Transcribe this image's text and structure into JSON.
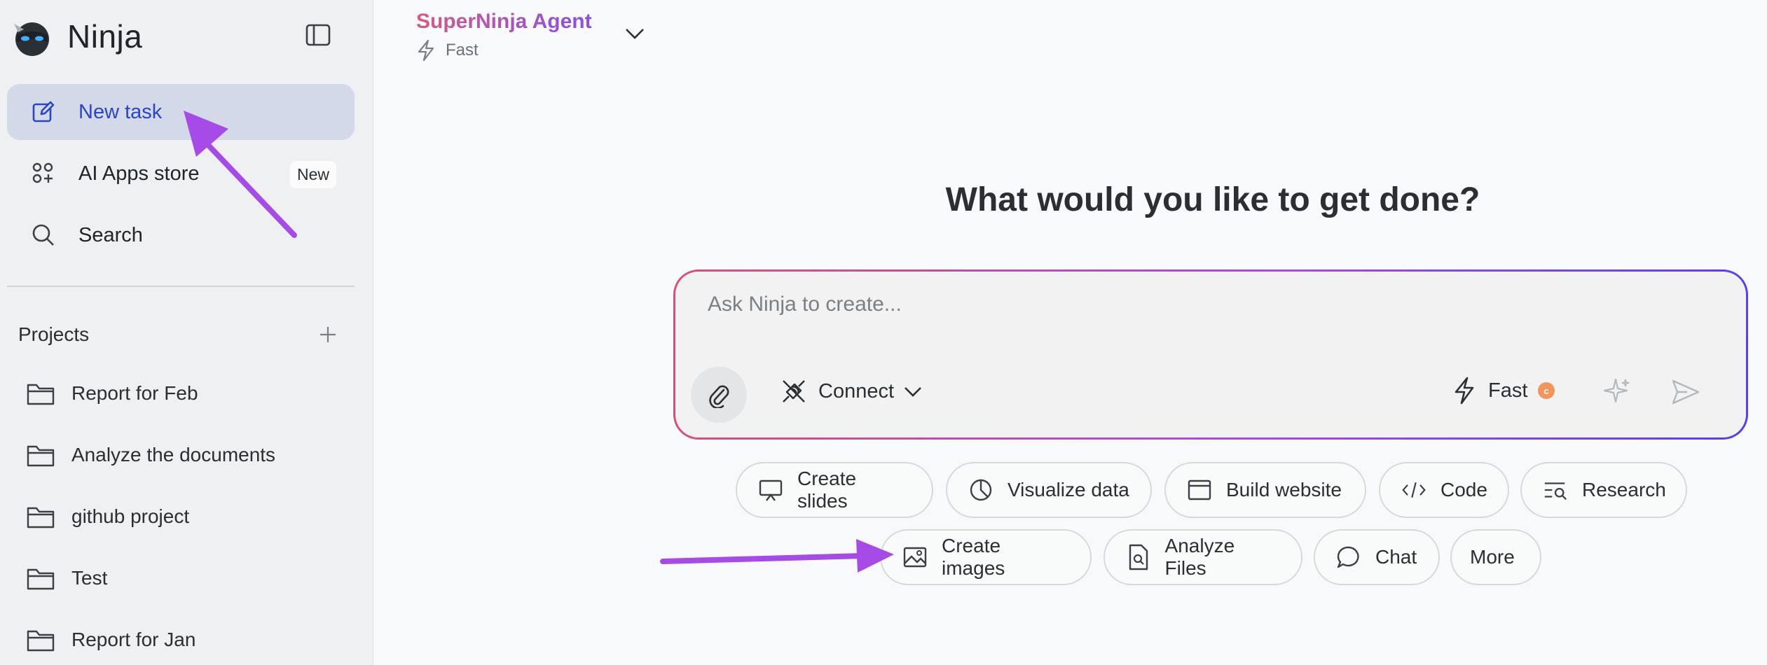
{
  "sidebar": {
    "brand": "Ninja",
    "nav": {
      "new_task": "New task",
      "apps_store": "AI Apps store",
      "apps_badge": "New",
      "search": "Search"
    },
    "projects_title": "Projects",
    "projects": [
      "Report for Feb",
      "Analyze the documents",
      "github project",
      "Test",
      "Report for Jan"
    ]
  },
  "header": {
    "agent_name": "SuperNinja Agent",
    "mode": "Fast"
  },
  "main": {
    "headline": "What would you like to get done?",
    "composer": {
      "placeholder": "Ask Ninja to create...",
      "connect_label": "Connect",
      "speed_label": "Fast"
    },
    "chips_row1": [
      "Create slides",
      "Visualize data",
      "Build website",
      "Code",
      "Research"
    ],
    "chips_row2": [
      "Create images",
      "Analyze Files",
      "Chat",
      "More"
    ]
  },
  "colors": {
    "accent_blue": "#2a45c6",
    "highlight": "#d3d9e9",
    "annotation_arrow": "#a64be8",
    "gradient_start": "#d8507a",
    "gradient_end": "#5a3cf0"
  },
  "icons": [
    "ninja-logo-icon",
    "sidebar-toggle-icon",
    "edit-icon",
    "apps-grid-icon",
    "search-icon",
    "plus-icon",
    "folder-icon",
    "bolt-icon",
    "chevron-down-icon",
    "paperclip-icon",
    "plug-icon",
    "sparkle-icon",
    "send-icon",
    "presentation-icon",
    "pie-chart-icon",
    "browser-window-icon",
    "code-icon",
    "research-icon",
    "image-icon",
    "file-search-icon",
    "chat-bubble-icon"
  ]
}
